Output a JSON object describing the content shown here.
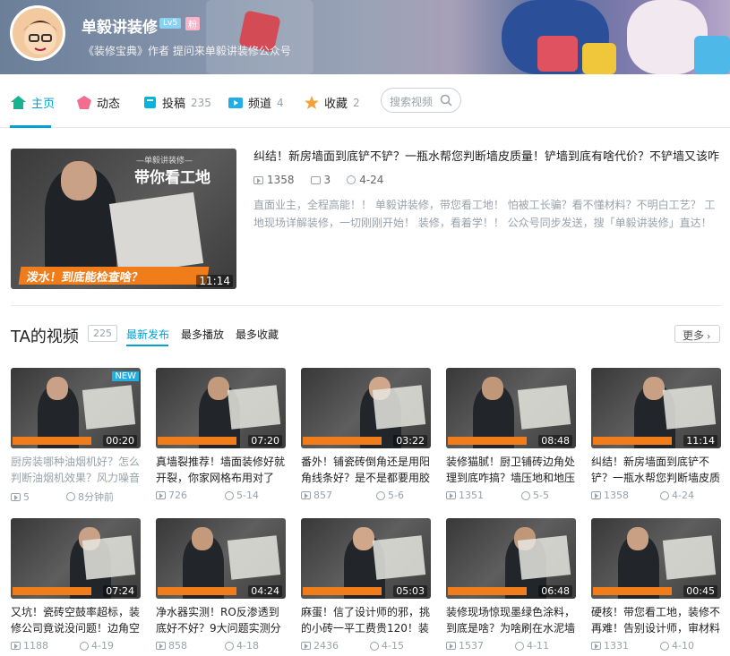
{
  "header": {
    "username": "单毅讲装修",
    "level": "Lv5",
    "fan_badge": "粉",
    "signature": "《装修宝典》作者 提问来单毅讲装修公众号"
  },
  "nav": {
    "home": "主页",
    "dynamic": "动态",
    "contribute": "投稿",
    "contribute_count": "235",
    "channel": "频道",
    "channel_count": "4",
    "favorites": "收藏",
    "favorites_count": "2",
    "search_placeholder": "搜索视频"
  },
  "featured": {
    "title": "纠结！新房墙面到底铲不铲？一瓶水帮您判断墙皮质量！铲墙到底有啥代价？不铲墙又该咋...",
    "plays": "1358",
    "comments": "3",
    "date": "4-24",
    "description": "直面业主，全程高能！！ 单毅讲装修，带您看工地！ 怕被工长骗？看不懂材料？不明白工艺？ 工地现场详解装修，一切刚刚开始！ 装修，看着学！！ 公众号同步发送，搜「单毅讲装修」直达！",
    "duration": "11:14",
    "thumb_top": "—单毅讲装修—",
    "thumb_big": "带你看工地",
    "thumb_caption": "泼水！到底能检查啥？"
  },
  "videos_section": {
    "title": "TA的视频",
    "count": "225",
    "sort_latest": "最新发布",
    "sort_plays": "最多播放",
    "sort_favs": "最多收藏",
    "more": "更多"
  },
  "videos": [
    {
      "title": "厨房装哪种油烟机好？怎么判断油烟机效果？风力噪音",
      "plays": "5",
      "date": "8分钟前",
      "duration": "00:20",
      "new": "NEW",
      "gray": true
    },
    {
      "title": "真墙裂推荐！墙面装修好就开裂，你家网格布用对了",
      "plays": "726",
      "date": "5-14",
      "duration": "07:20"
    },
    {
      "title": "番外！铺瓷砖倒角还是用阳角线条好？是不是都要用胶",
      "plays": "857",
      "date": "5-6",
      "duration": "03:22"
    },
    {
      "title": "装修猫腻！厨卫铺砖边角处理到底咋搞？墙压地和地压",
      "plays": "1351",
      "date": "5-5",
      "duration": "08:48"
    },
    {
      "title": "纠结！新房墙面到底铲不铲？一瓶水帮您判断墙皮质",
      "plays": "1358",
      "date": "4-24",
      "duration": "11:14"
    },
    {
      "title": "又坑！瓷砖空鼓率超标，装修公司竟说没问题！边角空",
      "plays": "1188",
      "date": "4-19",
      "duration": "07:24"
    },
    {
      "title": "净水器实测！RO反渗透到底好不好？9大问题实测分",
      "plays": "858",
      "date": "4-18",
      "duration": "04:24"
    },
    {
      "title": "麻蛋！信了设计师的邪，挑的小砖一平工费贵120！装",
      "plays": "2436",
      "date": "4-15",
      "duration": "05:03"
    },
    {
      "title": "装修现场惊现墨绿色涂料，到底是啥？为啥刷在水泥墙",
      "plays": "1537",
      "date": "4-11",
      "duration": "06:48"
    },
    {
      "title": "硬核！带您看工地，装修不再难！告别设计师，审材料",
      "plays": "1331",
      "date": "4-10",
      "duration": "00:45"
    }
  ],
  "colors": {
    "accent": "#00a1d6",
    "orange": "#f07c1a"
  }
}
